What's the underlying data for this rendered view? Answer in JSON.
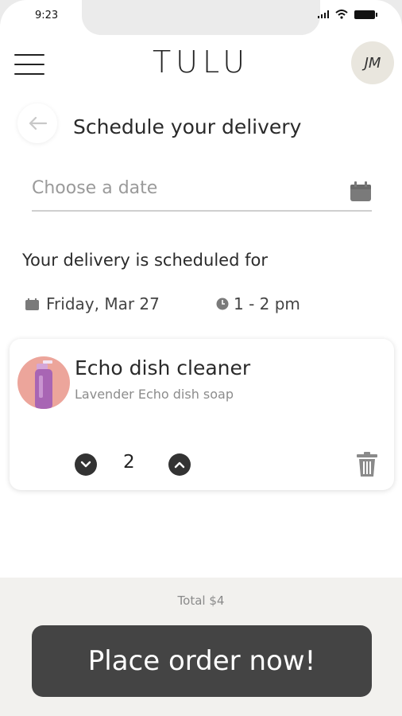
{
  "status": {
    "time": "9:23"
  },
  "header": {
    "brand": "TULU",
    "avatar_initials": "JM"
  },
  "page": {
    "title": "Schedule your delivery"
  },
  "date_field": {
    "placeholder": "Choose a date",
    "value": ""
  },
  "schedule": {
    "label": "Your delivery is scheduled for",
    "date": "Friday, Mar 27",
    "time": "1 - 2 pm"
  },
  "cart_item": {
    "name": "Echo dish cleaner",
    "description": "Lavender Echo dish soap",
    "quantity": "2"
  },
  "footer": {
    "total": "Total $4",
    "order_button": "Place order now!"
  },
  "colors": {
    "accent_dark": "#444444",
    "product_bg": "#eca59b",
    "avatar_bg": "#e9e6de",
    "footer_bg": "#f2f1ee"
  },
  "icons": [
    "menu-icon",
    "back-arrow-icon",
    "calendar-icon",
    "clock-icon",
    "chevron-down-icon",
    "chevron-up-icon",
    "trash-icon"
  ]
}
